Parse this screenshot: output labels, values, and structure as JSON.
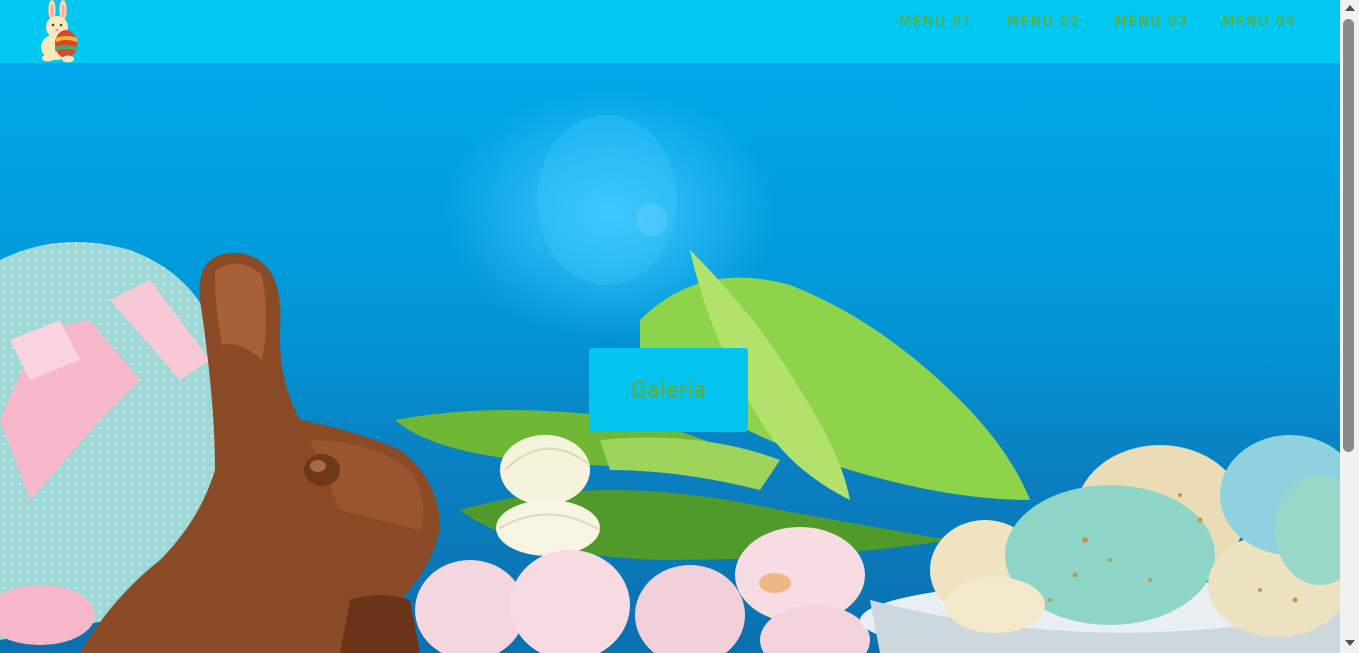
{
  "navbar": {
    "logo_name": "easter-bunny-egg-logo",
    "menu": [
      {
        "label": "MENU 01"
      },
      {
        "label": "MENU 02"
      },
      {
        "label": "MENU 03"
      },
      {
        "label": "MENU 04"
      }
    ]
  },
  "hero": {
    "image_name": "easter-hero-image",
    "button_label": "Galeria"
  },
  "colors": {
    "navbar_bg": "#00c8f0",
    "menu_text": "#6ea81e",
    "button_bg": "#03c4ef",
    "button_text": "#6ea81e"
  }
}
